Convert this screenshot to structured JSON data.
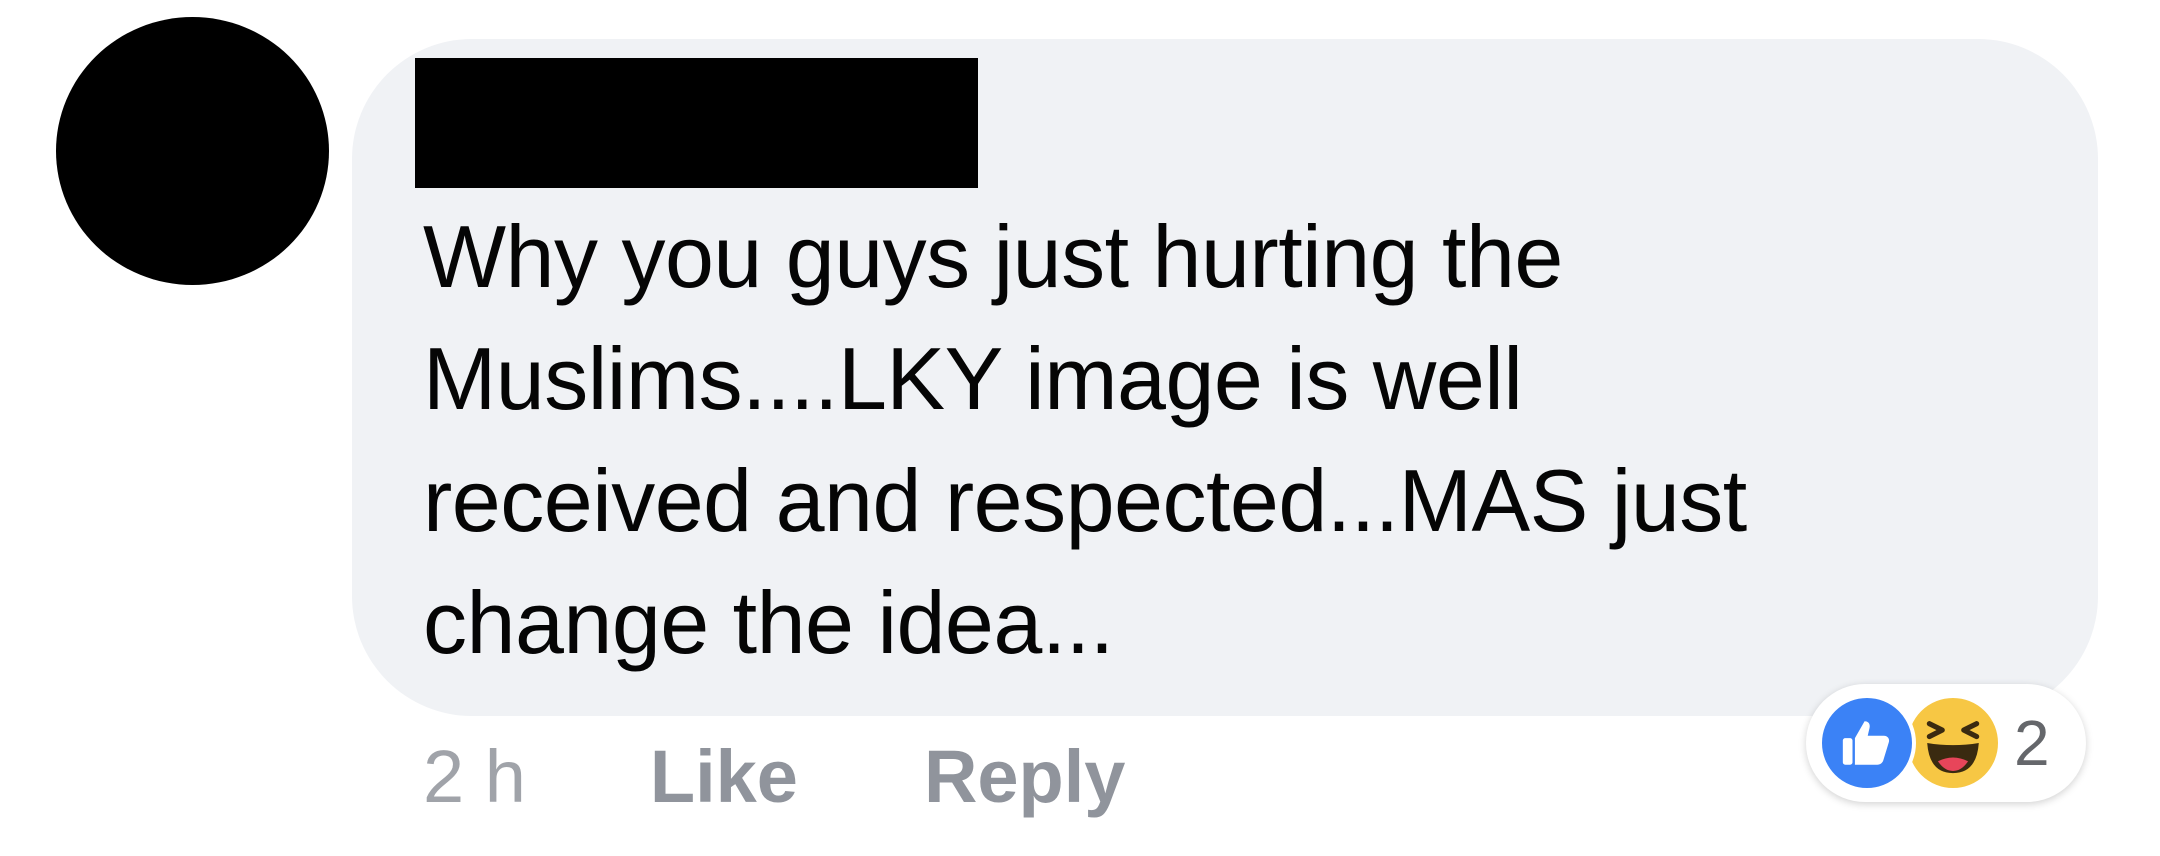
{
  "comment": {
    "text_lines": [
      "Why you guys just hurting the",
      "Muslims....LKY image is well",
      "received and respected...MAS just",
      "change the idea..."
    ],
    "timestamp": "2 h",
    "like_label": "Like",
    "reply_label": "Reply",
    "reactions": {
      "icons": [
        "thumbs-up-icon",
        "laughing-face-icon"
      ],
      "count": "2"
    }
  },
  "colors": {
    "bubble_bg": "#f0f2f5",
    "text": "#050505",
    "action_text": "#90949c",
    "like_blue": "#3b82f6",
    "haha_yellow": "#f7c744"
  }
}
